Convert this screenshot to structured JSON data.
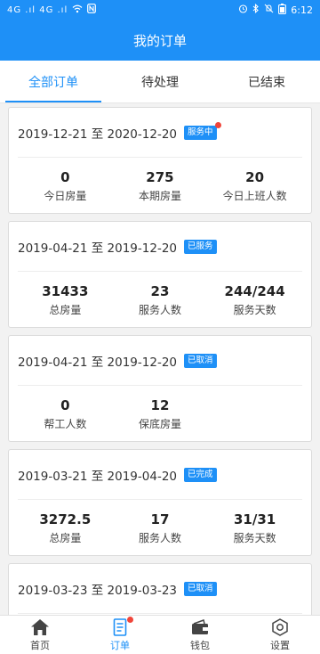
{
  "statusbar": {
    "signal": "4G .ıl 4G .ıl",
    "time": "6:12"
  },
  "header": {
    "title": "我的订单"
  },
  "tabs": [
    {
      "label": "全部订单",
      "active": true
    },
    {
      "label": "待处理",
      "active": false
    },
    {
      "label": "已结束",
      "active": false
    }
  ],
  "orders": [
    {
      "date_range": "2019-12-21 至 2020-12-20",
      "status": "服务中",
      "has_dot": true,
      "stats": [
        {
          "value": "0",
          "label": "今日房量"
        },
        {
          "value": "275",
          "label": "本期房量"
        },
        {
          "value": "20",
          "label": "今日上班人数"
        }
      ]
    },
    {
      "date_range": "2019-04-21 至 2019-12-20",
      "status": "已服务",
      "has_dot": false,
      "stats": [
        {
          "value": "31433",
          "label": "总房量"
        },
        {
          "value": "23",
          "label": "服务人数"
        },
        {
          "value": "244/244",
          "label": "服务天数"
        }
      ]
    },
    {
      "date_range": "2019-04-21 至 2019-12-20",
      "status": "已取消",
      "has_dot": false,
      "stats": [
        {
          "value": "0",
          "label": "帮工人数"
        },
        {
          "value": "12",
          "label": "保底房量"
        }
      ]
    },
    {
      "date_range": "2019-03-21 至 2019-04-20",
      "status": "已完成",
      "has_dot": false,
      "stats": [
        {
          "value": "3272.5",
          "label": "总房量"
        },
        {
          "value": "17",
          "label": "服务人数"
        },
        {
          "value": "31/31",
          "label": "服务天数"
        }
      ]
    },
    {
      "date_range": "2019-03-23 至 2019-03-23",
      "status": "已取消",
      "has_dot": false,
      "stats": []
    }
  ],
  "bottom_nav": [
    {
      "label": "首页",
      "icon": "home-icon",
      "active": false
    },
    {
      "label": "订单",
      "icon": "orders-icon",
      "active": true,
      "dot": true
    },
    {
      "label": "钱包",
      "icon": "wallet-icon",
      "active": false
    },
    {
      "label": "设置",
      "icon": "settings-icon",
      "active": false
    }
  ],
  "colors": {
    "primary": "#1e90f7",
    "dot": "#f0453a"
  }
}
